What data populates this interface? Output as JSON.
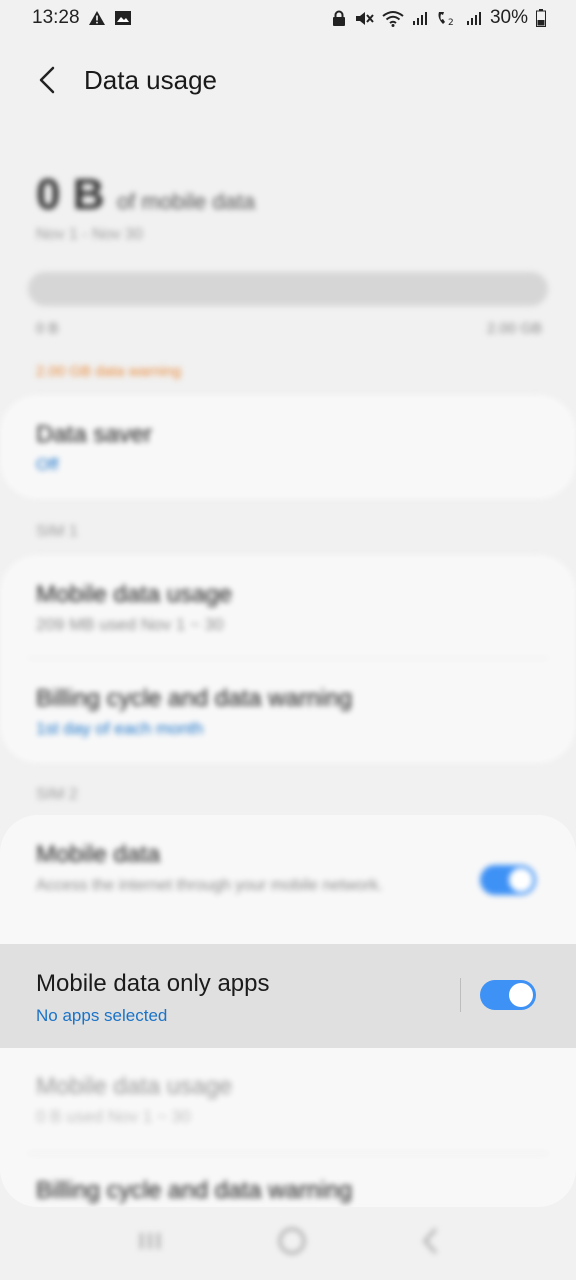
{
  "status_bar": {
    "time": "13:28",
    "battery": "30%",
    "left_icons": [
      "warning-icon",
      "image-icon"
    ],
    "right_icons": [
      "lock-icon",
      "mute-icon",
      "wifi-icon",
      "signal-icon",
      "volte-icon",
      "signal-icon-2",
      "battery-icon"
    ]
  },
  "app_bar": {
    "title": "Data usage",
    "back_icon": "back-arrow-icon"
  },
  "summary": {
    "value": "0 B",
    "unit_label": "of mobile data",
    "date_range": "Nov 1 - Nov 30",
    "scale_min": "0 B",
    "scale_max": "2.00 GB",
    "warning": "2.00 GB data warning",
    "usage_fraction": 0
  },
  "data_saver": {
    "title": "Data saver",
    "status": "Off"
  },
  "sim1": {
    "label": "SIM 1",
    "mobile_usage_title": "Mobile data usage",
    "mobile_usage_sub": "209 MB used Nov 1 ~ 30",
    "billing_title": "Billing cycle and data warning",
    "billing_sub": "1st day of each month"
  },
  "sim2": {
    "label": "SIM 2",
    "mobile_data_title": "Mobile data",
    "mobile_data_sub": "Access the internet through your mobile network.",
    "mobile_data_enabled": true,
    "only_apps_title": "Mobile data only apps",
    "only_apps_sub": "No apps selected",
    "only_apps_enabled": true,
    "usage_title": "Mobile data usage",
    "usage_sub": "0 B used Nov 1 ~ 30",
    "billing_title": "Billing cycle and data warning"
  },
  "nav_bar": {
    "recents_icon": "recents-icon",
    "home_icon": "home-icon",
    "back_icon": "nav-back-icon"
  },
  "colors": {
    "accent": "#3e91f5",
    "link_blue": "#1a73c8",
    "warning_orange": "#e8893a",
    "background": "#f1f1f1",
    "card": "#f8f8f8",
    "highlight": "#e0e0e0"
  }
}
